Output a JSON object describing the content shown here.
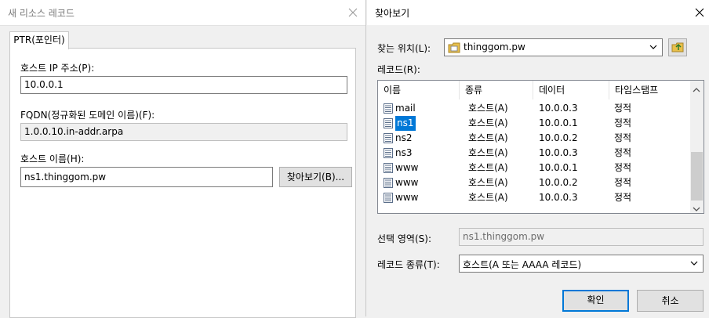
{
  "left_dialog": {
    "title": "새 리소스 레코드",
    "tab_label": "PTR(포인터)",
    "host_ip_label": "호스트 IP 주소(P):",
    "host_ip_value": "10.0.0.1",
    "fqdn_label": "FQDN(정규화된 도메인 이름)(F):",
    "fqdn_value": "1.0.0.10.in-addr.arpa",
    "host_name_label": "호스트 이름(H):",
    "host_name_value": "ns1.thinggom.pw",
    "browse_button": "찾아보기(B)..."
  },
  "right_dialog": {
    "title": "찾아보기",
    "look_in_label": "찾는 위치(L):",
    "look_in_value": "thinggom.pw",
    "records_label": "레코드(R):",
    "columns": [
      "이름",
      "종류",
      "데이터",
      "타임스탬프"
    ],
    "rows": [
      {
        "name": "mail",
        "type": "호스트(A)",
        "data": "10.0.0.3",
        "timestamp": "정적"
      },
      {
        "name": "ns1",
        "type": "호스트(A)",
        "data": "10.0.0.1",
        "timestamp": "정적"
      },
      {
        "name": "ns2",
        "type": "호스트(A)",
        "data": "10.0.0.2",
        "timestamp": "정적"
      },
      {
        "name": "ns3",
        "type": "호스트(A)",
        "data": "10.0.0.3",
        "timestamp": "정적"
      },
      {
        "name": "www",
        "type": "호스트(A)",
        "data": "10.0.0.1",
        "timestamp": "정적"
      },
      {
        "name": "www",
        "type": "호스트(A)",
        "data": "10.0.0.2",
        "timestamp": "정적"
      },
      {
        "name": "www",
        "type": "호스트(A)",
        "data": "10.0.0.3",
        "timestamp": "정적"
      }
    ],
    "selected_row_index": 1,
    "selection_label": "선택 영역(S):",
    "selection_value": "ns1.thinggom.pw",
    "record_type_label": "레코드 종류(T):",
    "record_type_value": "호스트(A 또는 AAAA 레코드)",
    "ok_button": "확인",
    "cancel_button": "취소"
  },
  "colors": {
    "selection_blue": "#0078d7",
    "window_bg": "#f0f0f0",
    "folder_yellow": "#e8c04a"
  },
  "icons": [
    "close-icon",
    "folder-icon",
    "folder-up-icon",
    "record-icon",
    "chevron-down-icon",
    "scroll-up-icon",
    "scroll-down-icon"
  ]
}
